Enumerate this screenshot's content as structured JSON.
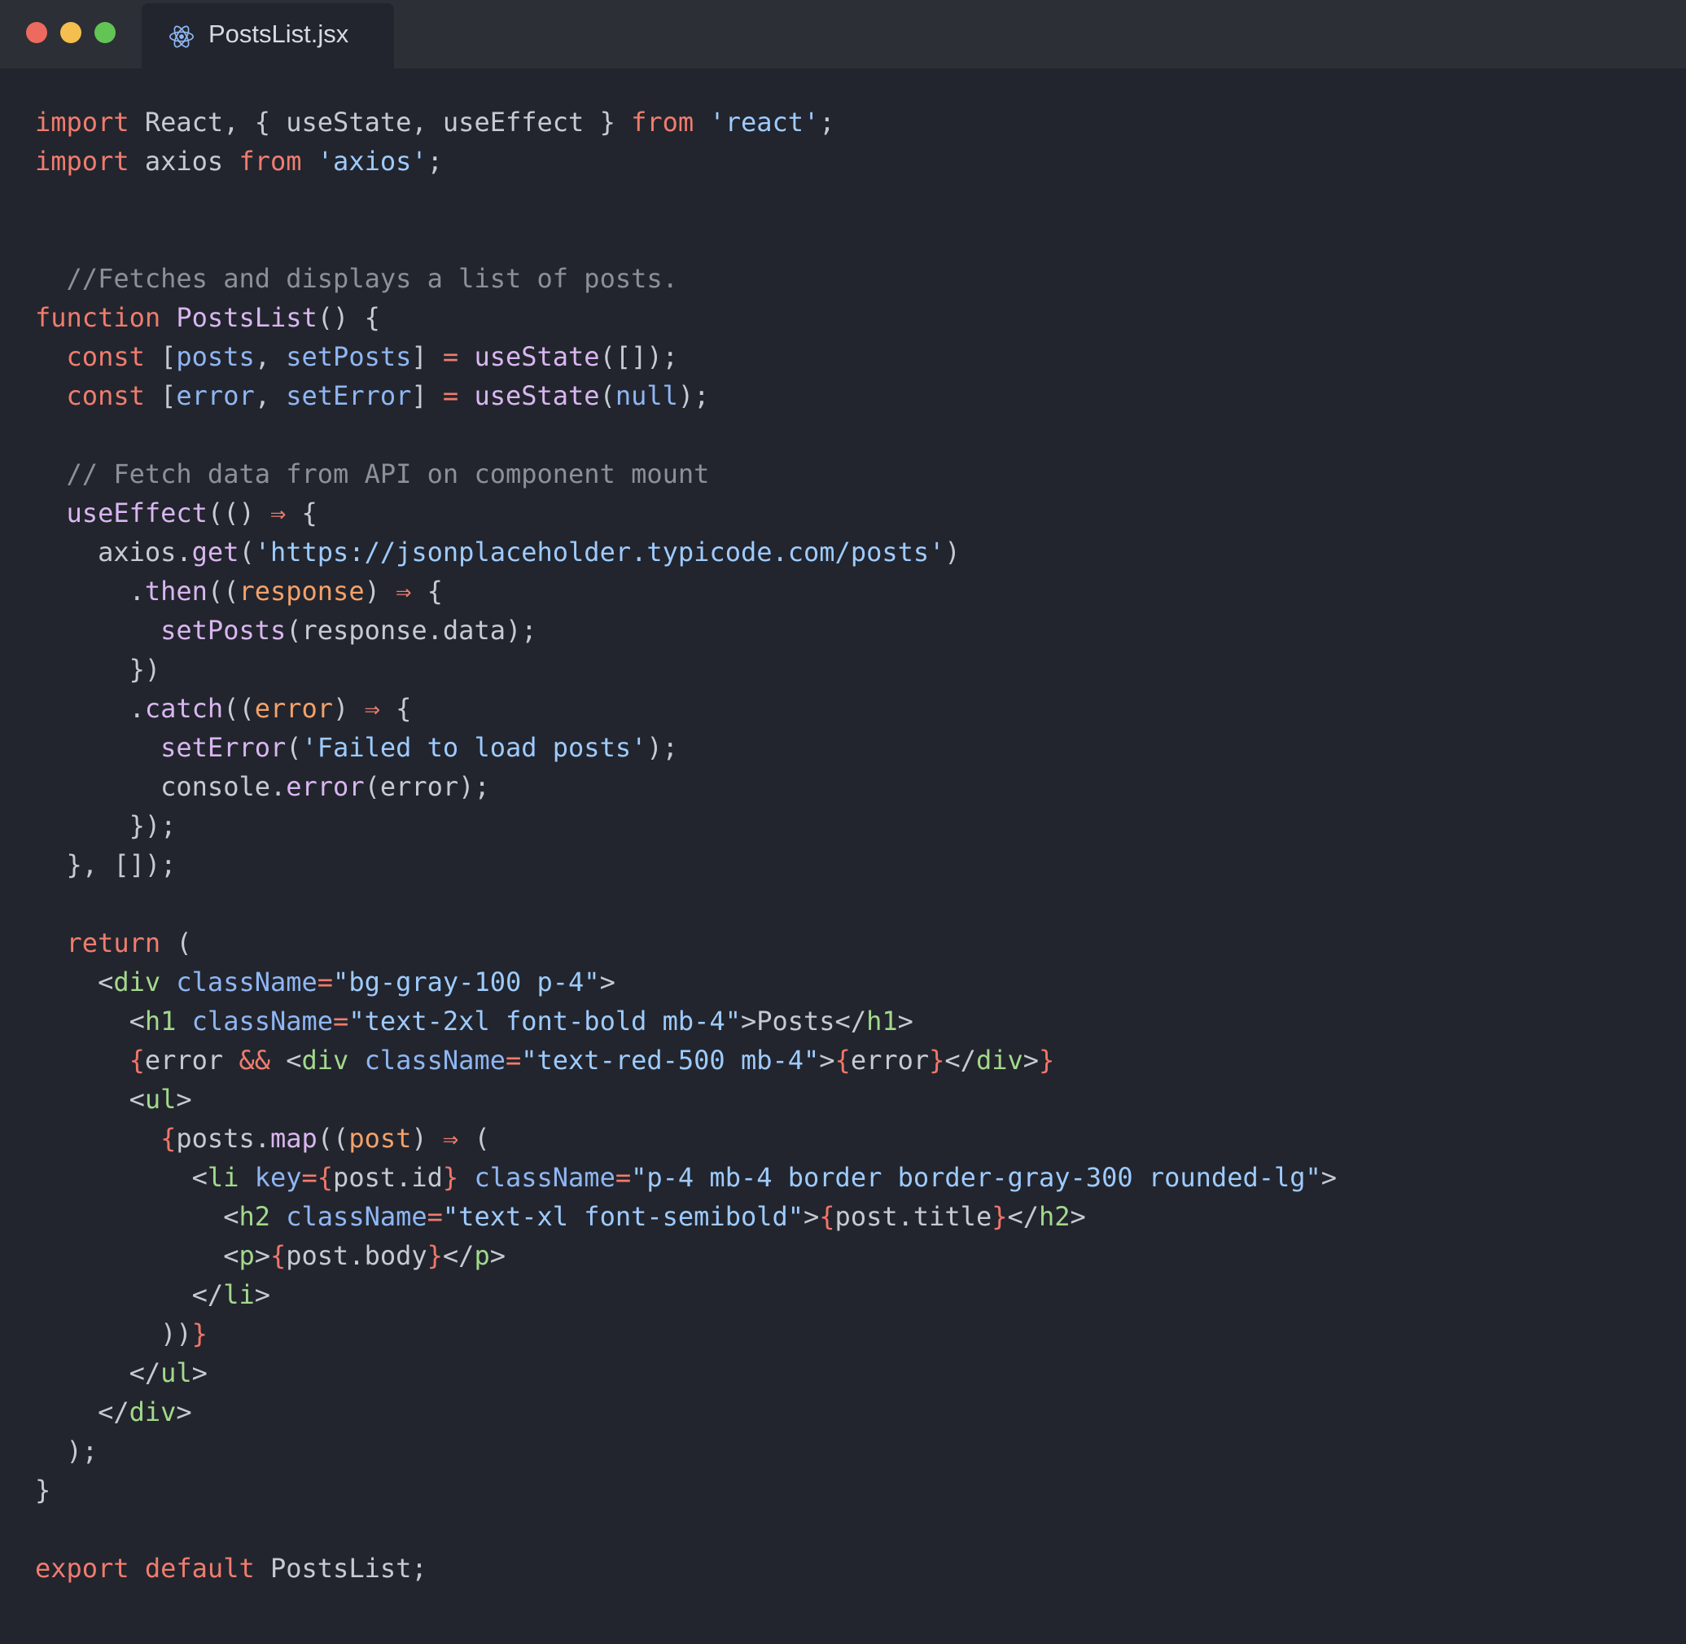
{
  "window": {
    "tab": {
      "filename": "PostsList.jsx",
      "icon": "react-icon"
    }
  },
  "code_lines": [
    [
      [
        "kw",
        "import"
      ],
      [
        "pl",
        " React, { useState, useEffect } "
      ],
      [
        "kw",
        "from"
      ],
      [
        "pl",
        " "
      ],
      [
        "str",
        "'react'"
      ],
      [
        "pl",
        ";"
      ]
    ],
    [
      [
        "kw",
        "import"
      ],
      [
        "pl",
        " axios "
      ],
      [
        "kw",
        "from"
      ],
      [
        "pl",
        " "
      ],
      [
        "str",
        "'axios'"
      ],
      [
        "pl",
        ";"
      ]
    ],
    [],
    [],
    [
      [
        "cmt",
        "  //Fetches and displays a list of posts."
      ]
    ],
    [
      [
        "kw",
        "function"
      ],
      [
        "pl",
        " "
      ],
      [
        "fn",
        "PostsList"
      ],
      [
        "pl",
        "() {"
      ]
    ],
    [
      [
        "pl",
        "  "
      ],
      [
        "kw",
        "const"
      ],
      [
        "pl",
        " ["
      ],
      [
        "var",
        "posts"
      ],
      [
        "pl",
        ", "
      ],
      [
        "var",
        "setPosts"
      ],
      [
        "pl",
        "] "
      ],
      [
        "kw",
        "="
      ],
      [
        "pl",
        " "
      ],
      [
        "fn",
        "useState"
      ],
      [
        "pl",
        "([]);"
      ]
    ],
    [
      [
        "pl",
        "  "
      ],
      [
        "kw",
        "const"
      ],
      [
        "pl",
        " ["
      ],
      [
        "var",
        "error"
      ],
      [
        "pl",
        ", "
      ],
      [
        "var",
        "setError"
      ],
      [
        "pl",
        "] "
      ],
      [
        "kw",
        "="
      ],
      [
        "pl",
        " "
      ],
      [
        "fn",
        "useState"
      ],
      [
        "pl",
        "("
      ],
      [
        "var",
        "null"
      ],
      [
        "pl",
        ");"
      ]
    ],
    [],
    [
      [
        "cmt",
        "  // Fetch data from API on component mount"
      ]
    ],
    [
      [
        "pl",
        "  "
      ],
      [
        "fn",
        "useEffect"
      ],
      [
        "pl",
        "(() "
      ],
      [
        "kw",
        "⇒"
      ],
      [
        "pl",
        " {"
      ]
    ],
    [
      [
        "pl",
        "    axios."
      ],
      [
        "fn",
        "get"
      ],
      [
        "pl",
        "("
      ],
      [
        "str",
        "'https://jsonplaceholder.typicode.com/posts'"
      ],
      [
        "pl",
        ")"
      ]
    ],
    [
      [
        "pl",
        "      ."
      ],
      [
        "fn",
        "then"
      ],
      [
        "pl",
        "(("
      ],
      [
        "prm",
        "response"
      ],
      [
        "pl",
        ") "
      ],
      [
        "kw",
        "⇒"
      ],
      [
        "pl",
        " {"
      ]
    ],
    [
      [
        "pl",
        "        "
      ],
      [
        "fn",
        "setPosts"
      ],
      [
        "pl",
        "(response.data);"
      ]
    ],
    [
      [
        "pl",
        "      })"
      ]
    ],
    [
      [
        "pl",
        "      ."
      ],
      [
        "fn",
        "catch"
      ],
      [
        "pl",
        "(("
      ],
      [
        "prm",
        "error"
      ],
      [
        "pl",
        ") "
      ],
      [
        "kw",
        "⇒"
      ],
      [
        "pl",
        " {"
      ]
    ],
    [
      [
        "pl",
        "        "
      ],
      [
        "fn",
        "setError"
      ],
      [
        "pl",
        "("
      ],
      [
        "str",
        "'Failed to load posts'"
      ],
      [
        "pl",
        ");"
      ]
    ],
    [
      [
        "pl",
        "        console."
      ],
      [
        "fn",
        "error"
      ],
      [
        "pl",
        "(error);"
      ]
    ],
    [
      [
        "pl",
        "      });"
      ]
    ],
    [
      [
        "pl",
        "  }, []);"
      ]
    ],
    [],
    [
      [
        "pl",
        "  "
      ],
      [
        "kw",
        "return"
      ],
      [
        "pl",
        " ("
      ]
    ],
    [
      [
        "pl",
        "    <"
      ],
      [
        "tag",
        "div"
      ],
      [
        "pl",
        " "
      ],
      [
        "attr",
        "className"
      ],
      [
        "kw",
        "="
      ],
      [
        "str",
        "\"bg-gray-100 p-4\""
      ],
      [
        "pl",
        ">"
      ]
    ],
    [
      [
        "pl",
        "      <"
      ],
      [
        "tag",
        "h1"
      ],
      [
        "pl",
        " "
      ],
      [
        "attr",
        "className"
      ],
      [
        "kw",
        "="
      ],
      [
        "str",
        "\"text-2xl font-bold mb-4\""
      ],
      [
        "pl",
        ">Posts</"
      ],
      [
        "tag",
        "h1"
      ],
      [
        "pl",
        ">"
      ]
    ],
    [
      [
        "pl",
        "      "
      ],
      [
        "brace",
        "{"
      ],
      [
        "pl",
        "error "
      ],
      [
        "kw",
        "&&"
      ],
      [
        "pl",
        " <"
      ],
      [
        "tag",
        "div"
      ],
      [
        "pl",
        " "
      ],
      [
        "attr",
        "className"
      ],
      [
        "kw",
        "="
      ],
      [
        "str",
        "\"text-red-500 mb-4\""
      ],
      [
        "pl",
        ">"
      ],
      [
        "brace",
        "{"
      ],
      [
        "pl",
        "error"
      ],
      [
        "brace",
        "}"
      ],
      [
        "pl",
        "</"
      ],
      [
        "tag",
        "div"
      ],
      [
        "pl",
        ">"
      ],
      [
        "brace",
        "}"
      ]
    ],
    [
      [
        "pl",
        "      <"
      ],
      [
        "tag",
        "ul"
      ],
      [
        "pl",
        ">"
      ]
    ],
    [
      [
        "pl",
        "        "
      ],
      [
        "brace",
        "{"
      ],
      [
        "pl",
        "posts."
      ],
      [
        "fn",
        "map"
      ],
      [
        "pl",
        "(("
      ],
      [
        "prm",
        "post"
      ],
      [
        "pl",
        ") "
      ],
      [
        "kw",
        "⇒"
      ],
      [
        "pl",
        " ("
      ]
    ],
    [
      [
        "pl",
        "          <"
      ],
      [
        "tag",
        "li"
      ],
      [
        "pl",
        " "
      ],
      [
        "attr",
        "key"
      ],
      [
        "kw",
        "="
      ],
      [
        "brace",
        "{"
      ],
      [
        "pl",
        "post.id"
      ],
      [
        "brace",
        "}"
      ],
      [
        "pl",
        " "
      ],
      [
        "attr",
        "className"
      ],
      [
        "kw",
        "="
      ],
      [
        "str",
        "\"p-4 mb-4 border border-gray-300 rounded-lg\""
      ],
      [
        "pl",
        ">"
      ]
    ],
    [
      [
        "pl",
        "            <"
      ],
      [
        "tag",
        "h2"
      ],
      [
        "pl",
        " "
      ],
      [
        "attr",
        "className"
      ],
      [
        "kw",
        "="
      ],
      [
        "str",
        "\"text-xl font-semibold\""
      ],
      [
        "pl",
        ">"
      ],
      [
        "brace",
        "{"
      ],
      [
        "pl",
        "post.title"
      ],
      [
        "brace",
        "}"
      ],
      [
        "pl",
        "</"
      ],
      [
        "tag",
        "h2"
      ],
      [
        "pl",
        ">"
      ]
    ],
    [
      [
        "pl",
        "            <"
      ],
      [
        "tag",
        "p"
      ],
      [
        "pl",
        ">"
      ],
      [
        "brace",
        "{"
      ],
      [
        "pl",
        "post.body"
      ],
      [
        "brace",
        "}"
      ],
      [
        "pl",
        "</"
      ],
      [
        "tag",
        "p"
      ],
      [
        "pl",
        ">"
      ]
    ],
    [
      [
        "pl",
        "          </"
      ],
      [
        "tag",
        "li"
      ],
      [
        "pl",
        ">"
      ]
    ],
    [
      [
        "pl",
        "        ))"
      ],
      [
        "brace",
        "}"
      ]
    ],
    [
      [
        "pl",
        "      </"
      ],
      [
        "tag",
        "ul"
      ],
      [
        "pl",
        ">"
      ]
    ],
    [
      [
        "pl",
        "    </"
      ],
      [
        "tag",
        "div"
      ],
      [
        "pl",
        ">"
      ]
    ],
    [
      [
        "pl",
        "  );"
      ]
    ],
    [
      [
        "pl",
        "}"
      ]
    ],
    [],
    [
      [
        "kw",
        "export"
      ],
      [
        "pl",
        " "
      ],
      [
        "kw",
        "default"
      ],
      [
        "pl",
        " PostsList;"
      ]
    ]
  ]
}
